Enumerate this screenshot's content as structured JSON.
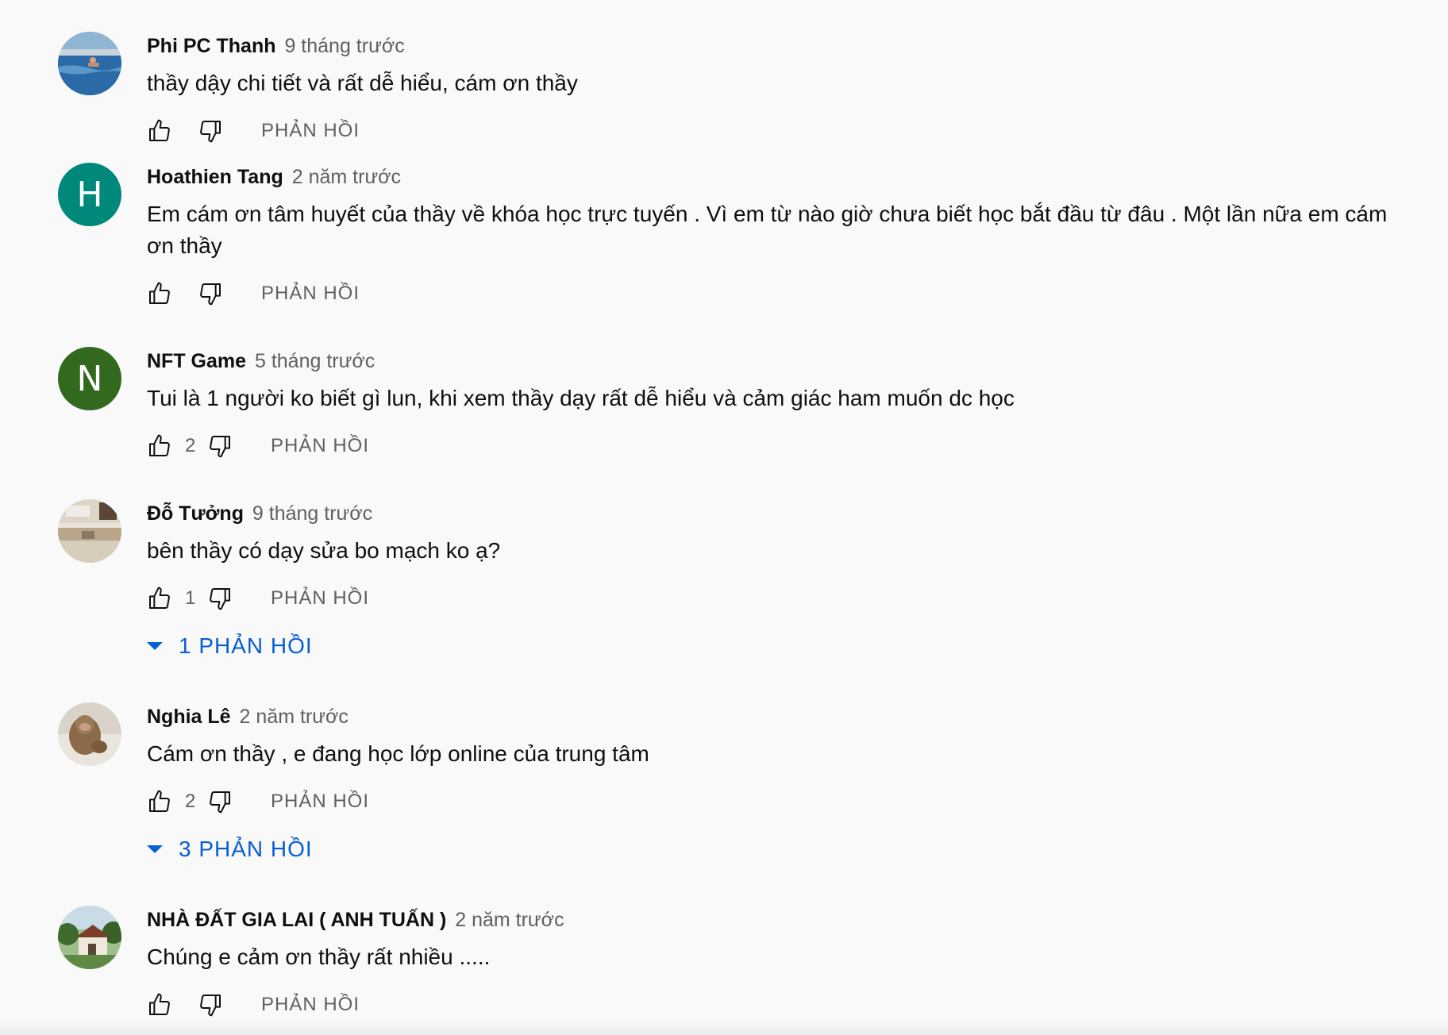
{
  "comments": [
    {
      "author": "Phi PC Thanh",
      "time": "9 tháng trước",
      "text": "thầy dậy chi tiết và rất dễ hiểu, cám ơn thầy",
      "likes": "",
      "reply_label": "PHẢN HỒI",
      "replies_label": "",
      "avatar": {
        "type": "image",
        "icon": "pool-photo-avatar",
        "color": "#2a5a8c"
      }
    },
    {
      "author": "Hoathien Tang",
      "time": "2 năm trước",
      "text": "Em cám ơn tâm huyết của thầy về khóa học trực tuyến . Vì em từ nào giờ chưa biết học bắt đầu từ đâu . Một lần nữa em cám ơn thầy",
      "likes": "",
      "reply_label": "PHẢN HỒI",
      "replies_label": "",
      "avatar": {
        "type": "letter",
        "letter": "H",
        "color": "#00897b"
      }
    },
    {
      "author": "NFT Game",
      "time": "5 tháng trước",
      "text": "Tui là 1 người ko biết gì lun, khi xem thầy dạy rất dễ hiểu và cảm giác ham muốn dc học",
      "likes": "2",
      "reply_label": "PHẢN HỒI",
      "replies_label": "",
      "avatar": {
        "type": "letter",
        "letter": "N",
        "color": "#33691e"
      }
    },
    {
      "author": "Đỗ Tưởng",
      "time": "9 tháng trước",
      "text": "bên thầy có dạy sửa bo mạch ko ạ?",
      "likes": "1",
      "reply_label": "PHẢN HỒI",
      "replies_label": "1 PHẢN HỒI",
      "avatar": {
        "type": "image",
        "icon": "kitchen-photo-avatar",
        "color": "#c8b8a0"
      }
    },
    {
      "author": "Nghia Lê",
      "time": "2 năm trước",
      "text": "Cám ơn thầy , e đang học lớp online của trung tâm",
      "likes": "2",
      "reply_label": "PHẢN HỒI",
      "replies_label": "3 PHẢN HỒI",
      "avatar": {
        "type": "image",
        "icon": "monkey-photo-avatar",
        "color": "#b8a48a"
      }
    },
    {
      "author": "NHÀ ĐẤT GIA LAI ( ANH TUẤN )",
      "time": "2 năm trước",
      "text": "Chúng e cảm ơn thầy rất nhiều .....",
      "likes": "",
      "reply_label": "PHẢN HỒI",
      "replies_label": "",
      "avatar": {
        "type": "image",
        "icon": "house-photo-avatar",
        "color": "#4a6a3a"
      }
    }
  ],
  "colors": {
    "background": "#f9f9f9",
    "author": "#0f0f0f",
    "secondary": "#606060",
    "link_blue": "#065fd4"
  }
}
